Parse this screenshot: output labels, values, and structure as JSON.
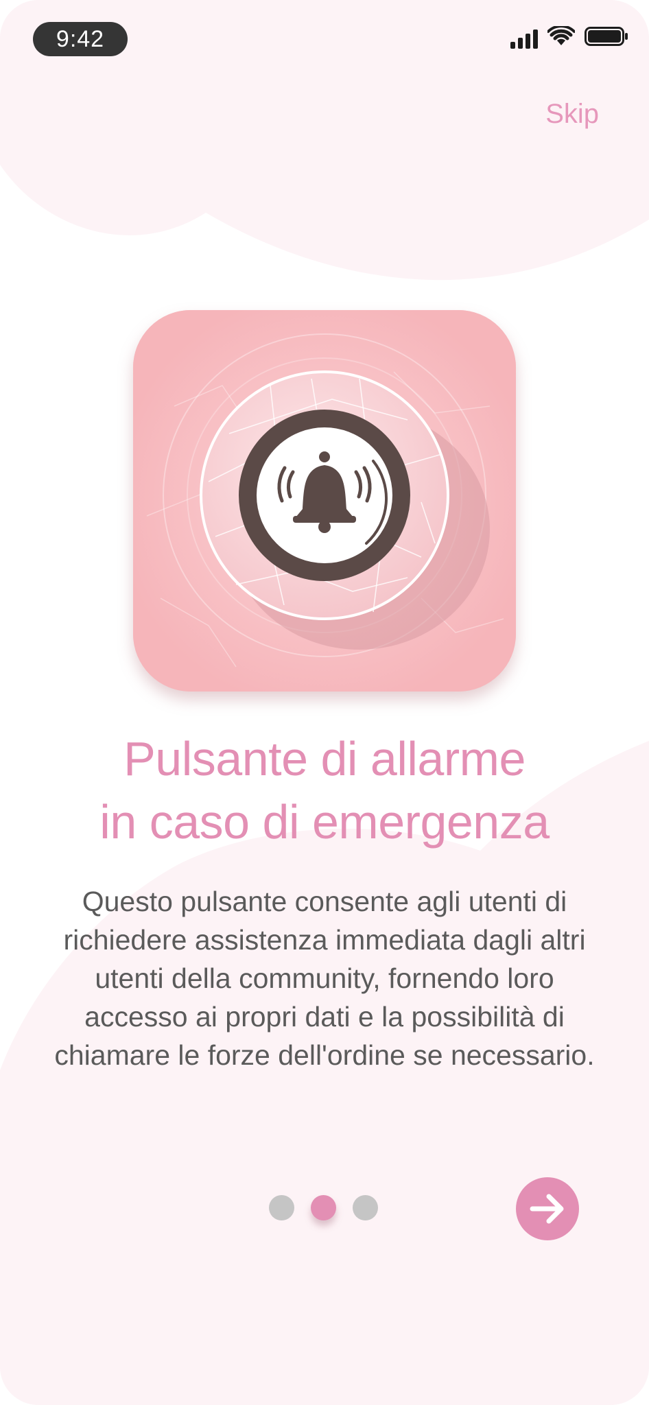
{
  "status_bar": {
    "time": "9:42",
    "icons": [
      "signal-icon",
      "wifi-icon",
      "battery-icon"
    ]
  },
  "header": {
    "skip_label": "Skip"
  },
  "hero": {
    "icon": "alarm-bell-icon"
  },
  "onboarding": {
    "title_line1": "Pulsante di allarme",
    "title_line2": "in caso di emergenza",
    "description": "Questo pulsante consente agli utenti di richiedere assistenza immediata dagli altri utenti della community, fornendo loro accesso ai propri dati e la possibilità di chiamare le forze dell'ordine se necessario."
  },
  "pager": {
    "total_pages": 3,
    "current_page": 2
  },
  "next_button": {
    "icon": "arrow-right-icon"
  },
  "colors": {
    "accent": "#e38fb4",
    "background": "#fdf3f6",
    "hero_background": "#f6b5ba",
    "bell": "#5b4a47",
    "text": "#5a5a5a",
    "inactive_dot": "#c5c5c5"
  }
}
